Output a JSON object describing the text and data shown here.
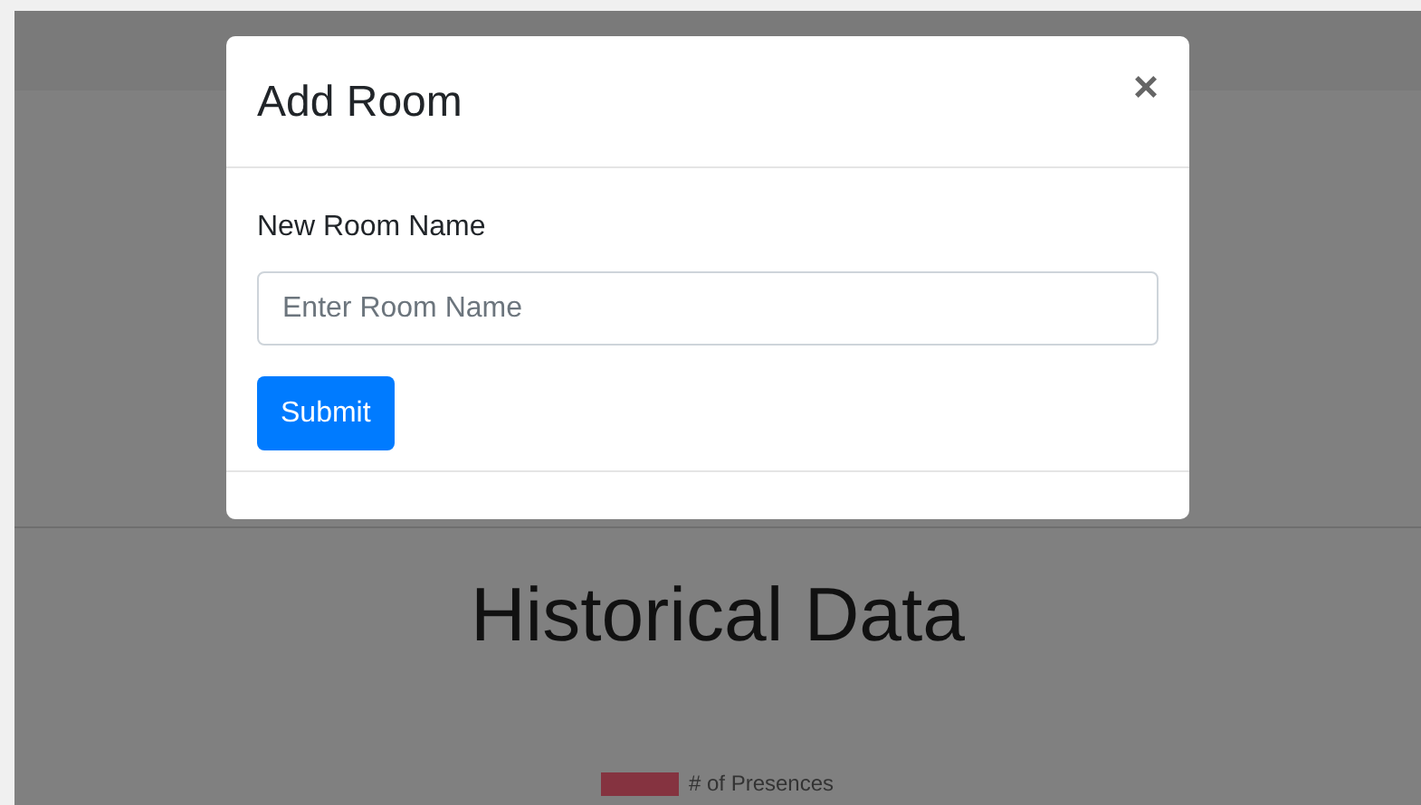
{
  "page": {
    "heading": "Historical Data",
    "legend": [
      {
        "label": "# of Presences",
        "color": "#853340"
      }
    ]
  },
  "modal": {
    "title": "Add Room",
    "close": "×",
    "field": {
      "label": "New Room Name",
      "placeholder": "Enter Room Name"
    },
    "button": "Submit"
  }
}
